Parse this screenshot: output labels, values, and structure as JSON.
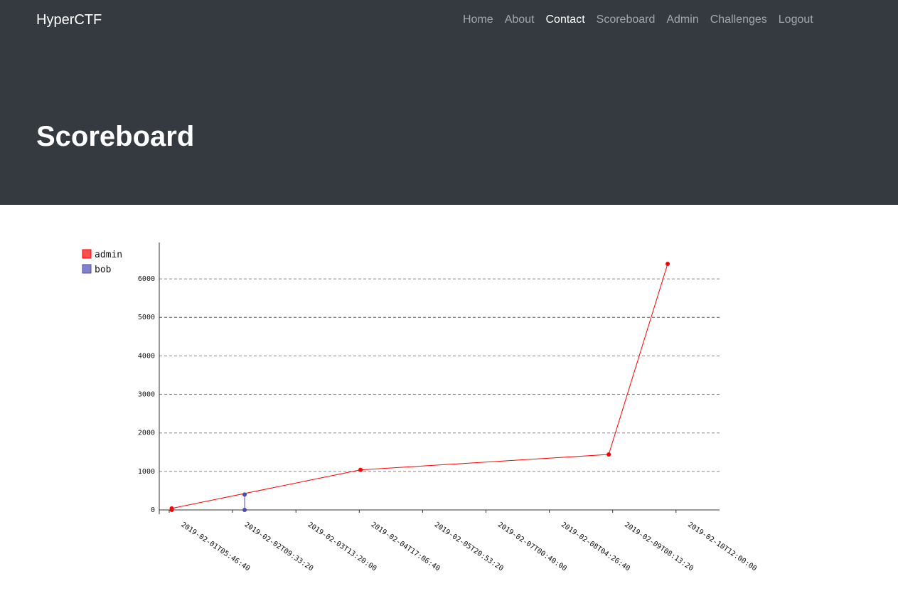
{
  "navbar": {
    "brand": "HyperCTF",
    "links": [
      {
        "label": "Home"
      },
      {
        "label": "About"
      },
      {
        "label": "Contact",
        "active": true
      },
      {
        "label": "Scoreboard"
      },
      {
        "label": "Admin"
      },
      {
        "label": "Challenges"
      },
      {
        "label": "Logout"
      }
    ]
  },
  "page": {
    "title": "Scoreboard"
  },
  "colors": {
    "header_bg": "#343a40",
    "admin": "#ff0000",
    "bob": "#4b4bb4"
  },
  "chart_data": {
    "type": "line",
    "legend_position": "top-left",
    "x_ticks": [
      "2019-02-01T05:46:40",
      "2019-02-02T09:33:20",
      "2019-02-03T13:20:00",
      "2019-02-04T17:06:40",
      "2019-02-05T20:53:20",
      "2019-02-07T00:40:00",
      "2019-02-08T04:26:40",
      "2019-02-09T08:13:20",
      "2019-02-10T12:00:00"
    ],
    "y_ticks": [
      0,
      1000,
      2000,
      3000,
      4000,
      5000,
      6000
    ],
    "ylim": [
      0,
      6500
    ],
    "grid": "horizontal-dashed",
    "series": [
      {
        "name": "admin",
        "color": "#ff0000",
        "points": [
          {
            "x": "2019-02-01T06:53:00",
            "y": 0
          },
          {
            "x": "2019-02-01T06:53:00",
            "y": 40
          },
          {
            "x": "2019-02-04T17:40:00",
            "y": 1040
          },
          {
            "x": "2019-02-09T06:30:00",
            "y": 1440
          },
          {
            "x": "2019-02-10T08:20:00",
            "y": 6390
          }
        ]
      },
      {
        "name": "bob",
        "color": "#4b4bb4",
        "points": [
          {
            "x": "2019-02-02T14:50:00",
            "y": 0
          },
          {
            "x": "2019-02-02T14:50:00",
            "y": 400
          }
        ]
      }
    ]
  }
}
